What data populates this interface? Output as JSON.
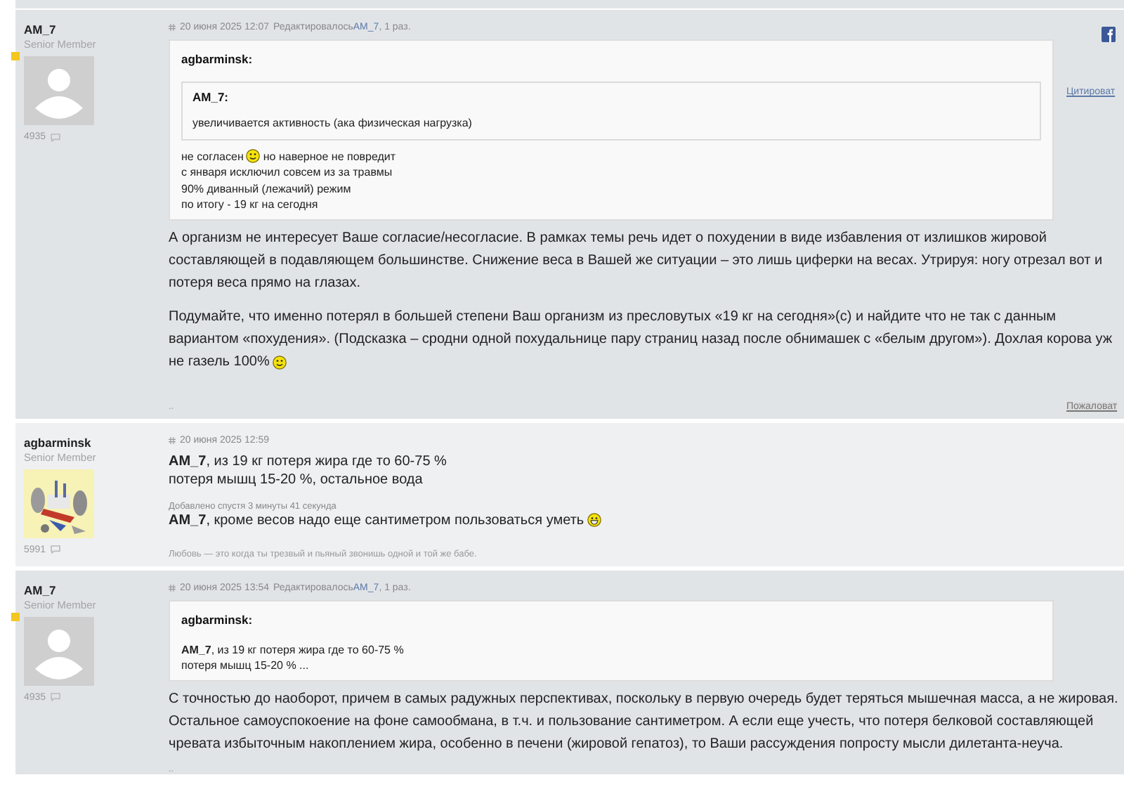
{
  "posts": [
    {
      "author": "AM_7",
      "rank": "Senior Member",
      "online": true,
      "avatar": {
        "kind": "placeholder"
      },
      "post_count": "4935",
      "meta": {
        "date": "20 июня 2025 12:07",
        "edit_note": "Редактировалось",
        "edit_by": "AM_7",
        "edit_suffix": ", 1 раз."
      },
      "quote": {
        "author": "agbarminsk:",
        "nested": {
          "author": "AM_7:",
          "lines": [
            "увеличивается активность (ака физическая нагрузка)"
          ]
        },
        "lines": [
          [
            {
              "kind": "text",
              "text": "не согласен"
            },
            {
              "kind": "smile"
            },
            {
              "kind": "text",
              "text": "но наверное не повредит"
            }
          ],
          "с января исключил совсем из за травмы",
          "90% диванный (лежачий) режим",
          "по итогу - 19 кг на сегодня"
        ]
      },
      "body": [
        {
          "kind": "paragraph",
          "lines": [
            "А организм не интересует Ваше согласие/несогласие. В рамках темы речь идет о похудении в виде избавления от излишков жировой",
            "составляющей в подавляющем большинстве. Снижение веса в Вашей же ситуации – это лишь циферки на весах. Утрируя: ногу отрезал вот и",
            "потеря веса прямо на глазах."
          ]
        },
        {
          "kind": "paragraph",
          "lines": [
            "Подумайте, что именно потерял в большей степени Ваш организм из пресловутых «19 кг на сегодня»(с) и найдите что не так с данным",
            "вариантом «похудения». (Подсказка – сродни одной похудальнице пару страниц назад после обнимашек с «белым другом»). Дохлая корова уж",
            [
              {
                "kind": "text",
                "text": "не газель 100%"
              },
              {
                "kind": "smile"
              }
            ]
          ]
        }
      ],
      "signature": "..",
      "share_icon": true,
      "quote_link": "Цитироват",
      "report_link": "Пожаловат"
    },
    {
      "author": "agbarminsk",
      "rank": "Senior Member",
      "online": false,
      "avatar": {
        "kind": "picture"
      },
      "post_count": "5991",
      "meta": {
        "date": "20 июня 2025 12:59"
      },
      "body": [
        {
          "kind": "paragraph",
          "lines": [
            "**AM_7**, из 19 кг потеря жира где то 60-75 %",
            "потеря мышц 15-20 %, остальное вода"
          ]
        },
        {
          "kind": "note",
          "text": "Добавлено спустя 3 минуты 41 секунда"
        },
        {
          "kind": "paragraph",
          "lines": [
            [
              {
                "kind": "text",
                "text": "**AM_7**, кроме весов надо еще сантиметром пользоваться уметь"
              },
              {
                "kind": "grin"
              }
            ]
          ]
        }
      ],
      "signature": "Любовь — это когда ты трезвый и пьяный звонишь одной и той же бабе."
    },
    {
      "author": "AM_7",
      "rank": "Senior Member",
      "online": true,
      "avatar": {
        "kind": "placeholder"
      },
      "post_count": "4935",
      "meta": {
        "date": "20 июня 2025 13:54",
        "edit_note": "Редактировалось",
        "edit_by": "AM_7",
        "edit_suffix": ", 1 раз."
      },
      "quote": {
        "author": "agbarminsk:",
        "lines": [
          "**AM_7**, из 19 кг потеря жира где то 60-75 %",
          "потеря мышц 15-20 % ..."
        ]
      },
      "body": [
        {
          "kind": "paragraph",
          "lines": [
            "С точностью до наоборот, причем в самых радужных перспективах, поскольку в первую очередь будет теряться мышечная масса, а не жировая.",
            "Остальное самоуспокоение на фоне самообмана, в т.ч. и пользование сантиметром. А если еще учесть, что потеря белковой составляющей",
            "чревата избыточным накоплением жира, особенно в печени (жировой гепатоз), то Ваши рассуждения попросту мысли дилетанта-неуча."
          ]
        }
      ],
      "signature": ".."
    }
  ]
}
